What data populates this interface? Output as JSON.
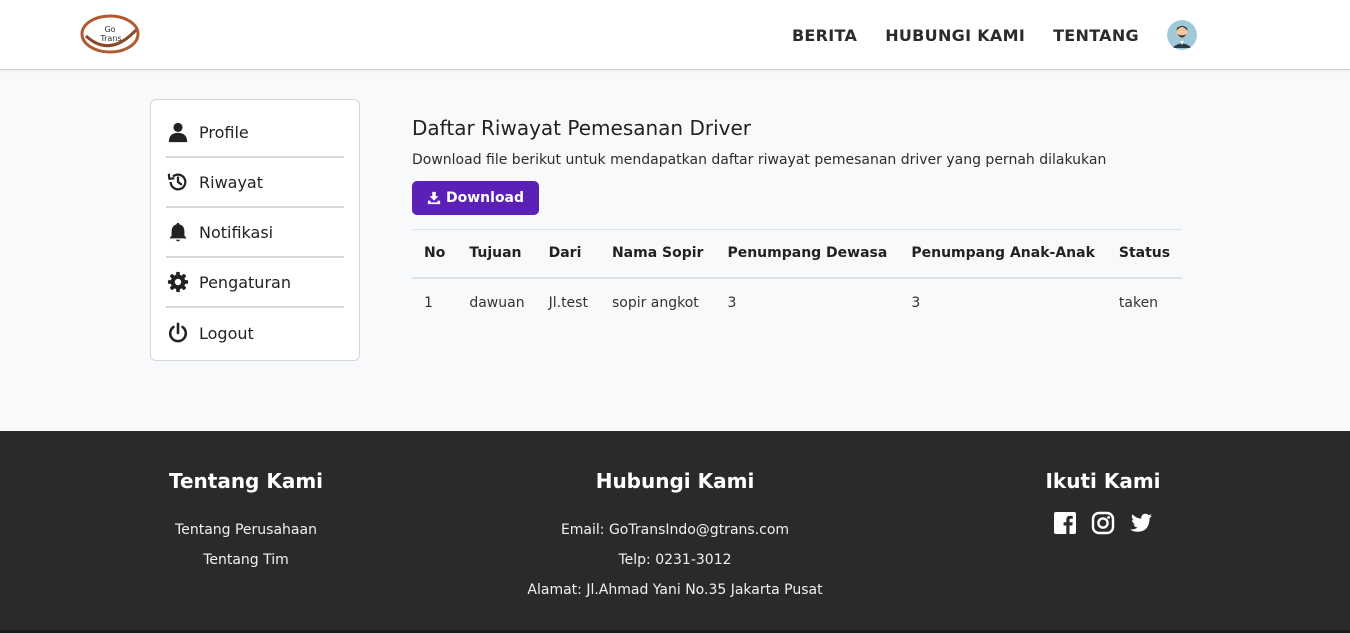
{
  "brand": {
    "logo_text_top": "Go",
    "logo_text_bottom": "Trans",
    "logo_color": "#b05a32"
  },
  "nav": {
    "links": [
      "BERITA",
      "HUBUNGI KAMI",
      "TENTANG"
    ],
    "avatar_icon": "user-avatar-icon"
  },
  "sidebar": {
    "items": [
      {
        "label": "Profile",
        "icon": "user-icon"
      },
      {
        "label": "Riwayat",
        "icon": "history-icon"
      },
      {
        "label": "Notifikasi",
        "icon": "bell-icon"
      },
      {
        "label": "Pengaturan",
        "icon": "gear-icon"
      },
      {
        "label": "Logout",
        "icon": "power-icon"
      }
    ]
  },
  "main": {
    "title": "Daftar Riwayat Pemesanan Driver",
    "description": "Download file berikut untuk mendapatkan daftar riwayat pemesanan driver yang pernah dilakukan",
    "download_label": "Download",
    "accent_color": "#5b21b6"
  },
  "table": {
    "headers": [
      "No",
      "Tujuan",
      "Dari",
      "Nama Sopir",
      "Penumpang Dewasa",
      "Penumpang Anak-Anak",
      "Status"
    ],
    "rows": [
      [
        "1",
        "dawuan",
        "Jl.test",
        "sopir angkot",
        "3",
        "3",
        "taken"
      ]
    ]
  },
  "footer": {
    "about": {
      "title": "Tentang Kami",
      "links": [
        "Tentang Perusahaan",
        "Tentang Tim"
      ]
    },
    "contact": {
      "title": "Hubungi Kami",
      "email": "Email: GoTransIndo@gtrans.com",
      "phone": "Telp: 0231-3012",
      "address": "Alamat: Jl.Ahmad Yani No.35 Jakarta Pusat"
    },
    "follow": {
      "title": "Ikuti Kami",
      "icons": [
        "facebook-icon",
        "instagram-icon",
        "twitter-icon"
      ]
    },
    "background": "#2a2a2a"
  }
}
